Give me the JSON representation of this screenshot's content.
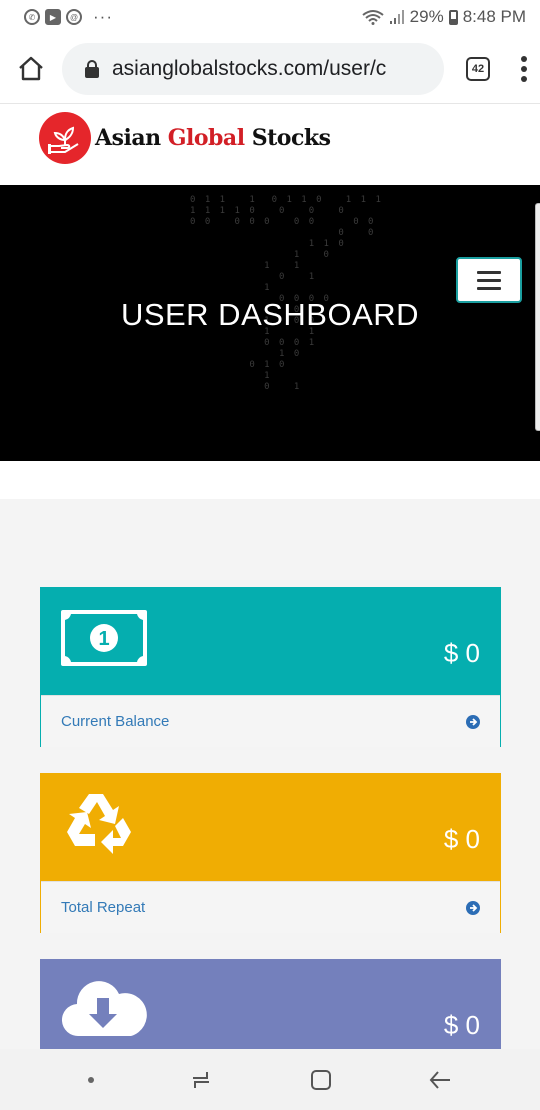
{
  "status_bar": {
    "battery": "29%",
    "time": "8:48 PM",
    "overflow": "···"
  },
  "browser": {
    "url": "asianglobalstocks.com/user/c",
    "tab_count": "42"
  },
  "logo": {
    "word1": "Asian",
    "word2": "Global",
    "word3": "Stocks"
  },
  "hero": {
    "title": "USER DASHBOARD"
  },
  "cards": [
    {
      "label": "Current Balance",
      "value": "$ 0",
      "color": "#05aeaf",
      "icon": "money-bill-icon"
    },
    {
      "label": "Total Repeat",
      "value": "$ 0",
      "color": "#f0ad03",
      "icon": "recycle-icon"
    },
    {
      "label": "",
      "value": "$ 0",
      "color": "#7480bc",
      "icon": "cloud-download-icon"
    }
  ],
  "colors": {
    "brand_red": "#e5262b",
    "teal": "#05aeaf",
    "amber": "#f0ad03",
    "periwinkle": "#7480bc",
    "link_blue": "#337ab7"
  }
}
